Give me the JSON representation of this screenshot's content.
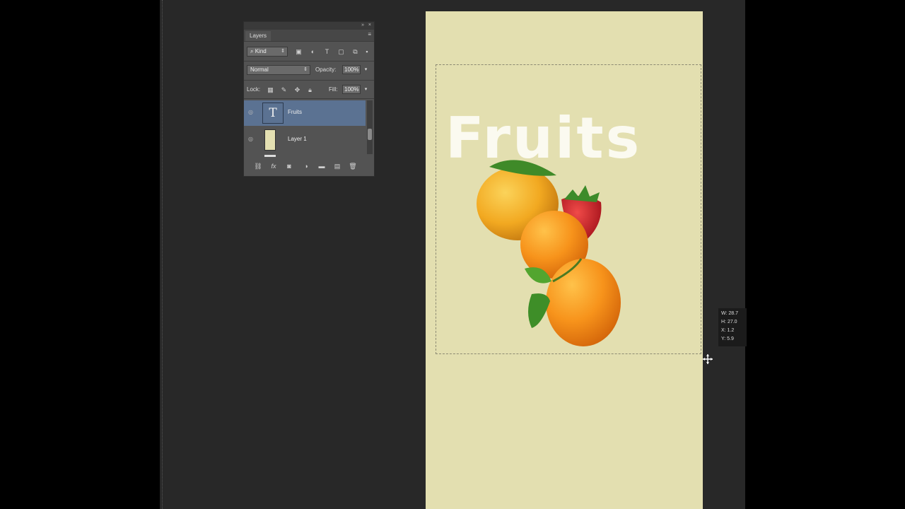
{
  "layers_panel": {
    "tab_label": "Layers",
    "filter_kind": "Kind",
    "blend_mode": "Normal",
    "opacity_label": "Opacity:",
    "opacity_value": "100%",
    "lock_label": "Lock:",
    "fill_label": "Fill:",
    "fill_value": "100%",
    "layers": [
      {
        "name": "Fruits",
        "type": "text",
        "selected": true,
        "thumb_glyph": "T"
      },
      {
        "name": "Layer 1",
        "type": "fill",
        "selected": false,
        "thumb_color": "#e4e0b2"
      }
    ]
  },
  "document": {
    "background_color": "#e3dfb0",
    "title_text": "Fruits",
    "title_color": "#fbfaf0"
  },
  "transform_readout": {
    "w": "W: 28.7",
    "h": "H: 27.0",
    "x": "X: 1.2",
    "y": "Y: 5.9"
  },
  "icons": [
    "eye-icon",
    "text-layer-icon",
    "link-icon",
    "fx-icon",
    "mask-icon",
    "adjustment-icon",
    "folder-icon",
    "new-layer-icon",
    "trash-icon",
    "move-cursor-icon"
  ]
}
